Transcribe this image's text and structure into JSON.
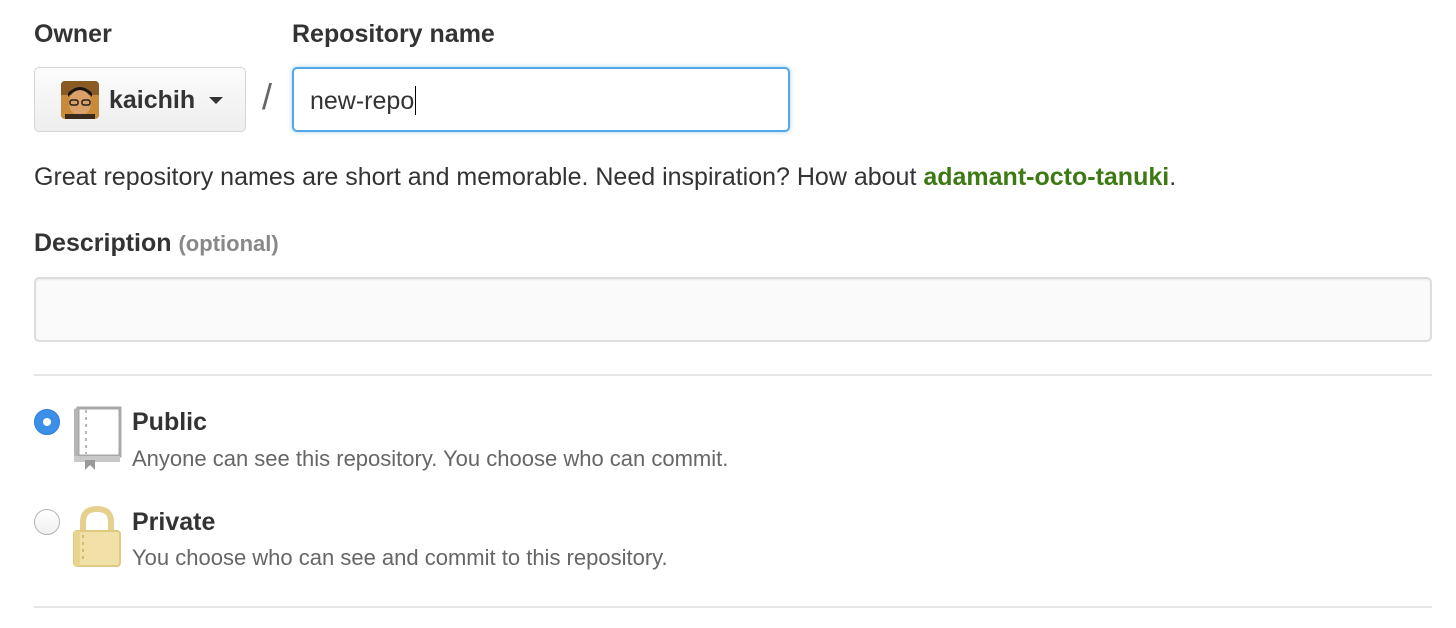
{
  "owner": {
    "label": "Owner",
    "selected": "kaichih",
    "avatar_icon": "user-avatar"
  },
  "separator": "/",
  "repository": {
    "label": "Repository name",
    "value": "new-repo"
  },
  "hint": {
    "text": "Great repository names are short and memorable. Need inspiration? How about ",
    "suggestion": "adamant-octo-tanuki",
    "suffix": "."
  },
  "description": {
    "label": "Description",
    "optional": "(optional)",
    "value": "",
    "placeholder": ""
  },
  "visibility": {
    "options": [
      {
        "title": "Public",
        "description": "Anyone can see this repository. You choose who can commit.",
        "selected": true,
        "icon": "repo-book-icon"
      },
      {
        "title": "Private",
        "description": "You choose who can see and commit to this repository.",
        "selected": false,
        "icon": "lock-icon"
      }
    ]
  },
  "colors": {
    "accent": "#51a7e8",
    "radio_selected": "#3b8fe8",
    "suggestion": "#3d7a14",
    "lock": "#e6d08f"
  }
}
